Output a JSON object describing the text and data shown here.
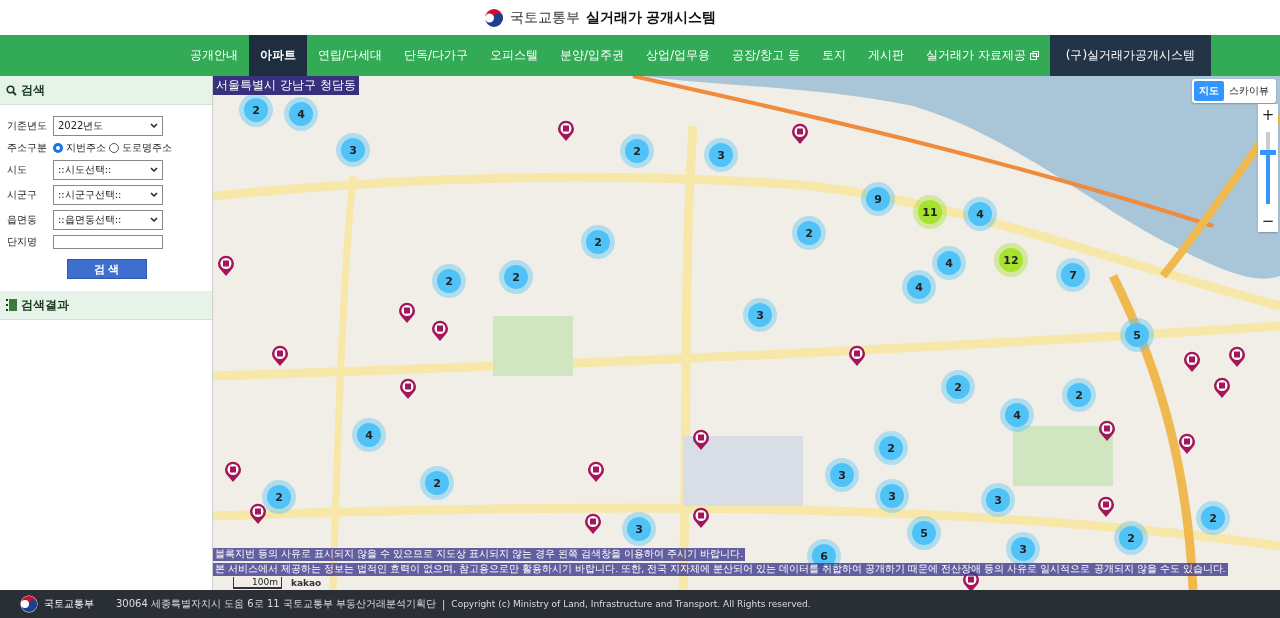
{
  "header": {
    "ministry": "국토교통부",
    "title": "실거래가 공개시스템"
  },
  "nav": [
    {
      "label": "공개안내",
      "selected": false,
      "kind": "tab"
    },
    {
      "label": "아파트",
      "selected": true,
      "kind": "tab"
    },
    {
      "label": "연립/다세대",
      "selected": false,
      "kind": "tab"
    },
    {
      "label": "단독/다가구",
      "selected": false,
      "kind": "tab"
    },
    {
      "label": "오피스텔",
      "selected": false,
      "kind": "tab"
    },
    {
      "label": "분양/입주권",
      "selected": false,
      "kind": "tab"
    },
    {
      "label": "상업/업무용",
      "selected": false,
      "kind": "tab"
    },
    {
      "label": "공장/창고 등",
      "selected": false,
      "kind": "tab"
    },
    {
      "label": "토지",
      "selected": false,
      "kind": "tab"
    },
    {
      "label": "게시판",
      "selected": false,
      "kind": "tab"
    },
    {
      "label": "실거래가 자료제공",
      "selected": false,
      "kind": "external"
    },
    {
      "label": "(구)실거래가공개시스템",
      "selected": false,
      "kind": "legacy"
    }
  ],
  "search": {
    "title": "검색",
    "fields": [
      {
        "kind": "select",
        "label": "기준년도",
        "value": "2022년도"
      },
      {
        "kind": "radio",
        "label": "주소구분",
        "options": [
          {
            "label": "지번주소",
            "selected": true
          },
          {
            "label": "도로명주소",
            "selected": false
          }
        ]
      },
      {
        "kind": "select",
        "label": "시도",
        "value": "::시도선택::"
      },
      {
        "kind": "select",
        "label": "시군구",
        "value": "::시군구선택::"
      },
      {
        "kind": "select",
        "label": "읍면동",
        "value": "::읍면동선택::"
      },
      {
        "kind": "text",
        "label": "단지명"
      }
    ],
    "button": "검 색"
  },
  "results": {
    "title": "검색결과"
  },
  "map": {
    "location": "서울특별시 강남구 청담동",
    "map_types": [
      {
        "label": "지도",
        "selected": true
      },
      {
        "label": "스카이뷰",
        "selected": false
      }
    ],
    "zoom": {
      "plus": "+",
      "minus": "−",
      "level": 0.75
    },
    "clusters": [
      {
        "count": "2",
        "color": "#4fc3f7"
      },
      {
        "count": "4",
        "color": "#4fc3f7"
      },
      {
        "count": "3",
        "color": "#4fc3f7"
      },
      {
        "count": "2",
        "color": "#4fc3f7"
      },
      {
        "count": "3",
        "color": "#4fc3f7"
      },
      {
        "count": "9",
        "color": "#4fc3f7"
      },
      {
        "count": "11",
        "color": "#a6e22e"
      },
      {
        "count": "4",
        "color": "#4fc3f7"
      },
      {
        "count": "2",
        "color": "#4fc3f7"
      },
      {
        "count": "2",
        "color": "#4fc3f7"
      },
      {
        "count": "4",
        "color": "#4fc3f7"
      },
      {
        "count": "12",
        "color": "#a6e22e"
      },
      {
        "count": "7",
        "color": "#4fc3f7"
      },
      {
        "count": "2",
        "color": "#4fc3f7"
      },
      {
        "count": "2",
        "color": "#4fc3f7"
      },
      {
        "count": "4",
        "color": "#4fc3f7"
      },
      {
        "count": "3",
        "color": "#4fc3f7"
      },
      {
        "count": "5",
        "color": "#4fc3f7"
      },
      {
        "count": "2",
        "color": "#4fc3f7"
      },
      {
        "count": "2",
        "color": "#4fc3f7"
      },
      {
        "count": "4",
        "color": "#4fc3f7"
      },
      {
        "count": "4",
        "color": "#4fc3f7"
      },
      {
        "count": "2",
        "color": "#4fc3f7"
      },
      {
        "count": "3",
        "color": "#4fc3f7"
      },
      {
        "count": "2",
        "color": "#4fc3f7"
      },
      {
        "count": "2",
        "color": "#4fc3f7"
      },
      {
        "count": "3",
        "color": "#4fc3f7"
      },
      {
        "count": "3",
        "color": "#4fc3f7"
      },
      {
        "count": "5",
        "color": "#4fc3f7"
      },
      {
        "count": "2",
        "color": "#4fc3f7"
      },
      {
        "count": "2",
        "color": "#4fc3f7"
      },
      {
        "count": "3",
        "color": "#4fc3f7"
      },
      {
        "count": "3",
        "color": "#4fc3f7"
      },
      {
        "count": "6",
        "color": "#4fc3f7"
      }
    ],
    "notices": [
      "블록지번 등의 사유로 표시되지 않을 수 있으므로 지도상 표시되지 않는 경우 왼쪽 검색창을 이용하여 주시기 바랍니다.",
      "본 서비스에서 제공하는 정보는 법적인 효력이 없으며, 참고용으로만 활용하시기 바랍니다. 또한, 전국 지자체에 분산되어 있는 데이터를 취합하여 공개하기 때문에 전산장애 등의 사유로 일시적으로 공개되지 않을 수도 있습니다."
    ],
    "scale": "100m",
    "provider": "kakao"
  },
  "footer": {
    "ministry": "국토교통부",
    "address": "30064 세종특별자치시 도움 6로 11 국토교통부 부동산거래분석기획단",
    "separator": "|",
    "copyright": "Copyright (c) Ministry of Land, Infrastructure and Transport. All Rights reserved."
  }
}
